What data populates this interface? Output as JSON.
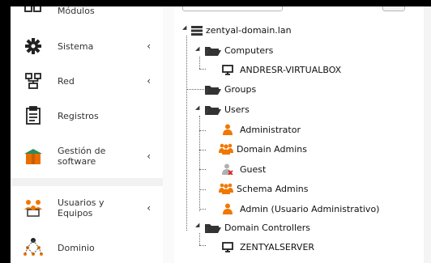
{
  "sidebar": {
    "items": [
      {
        "label": "Módulos",
        "icon": "modules-icon"
      },
      {
        "label": "Sistema",
        "icon": "gear-icon",
        "chevron": "‹"
      },
      {
        "label": "Red",
        "icon": "network-icon",
        "chevron": "‹"
      },
      {
        "label": "Registros",
        "icon": "clipboard-icon"
      },
      {
        "label": "Gestión de software",
        "icon": "software-box-icon",
        "chevron": "‹"
      },
      {
        "label": "Usuarios y Equipos",
        "icon": "users-group-icon",
        "chevron": "‹"
      },
      {
        "label": "Dominio",
        "icon": "domain-icon"
      }
    ]
  },
  "tree": {
    "root": "zentyal-domain.lan",
    "computers": "Computers",
    "computer_1": "ANDRESR-VIRTUALBOX",
    "groups": "Groups",
    "users": "Users",
    "user_1": "Administrator",
    "user_2": "Domain Admins",
    "user_3": "Guest",
    "user_4": "Schema Admins",
    "user_5": "Admin (Usuario Administrativo)",
    "dcs": "Domain Controllers",
    "dc_1": "ZENTYALSERVER"
  },
  "colors": {
    "user_orange": "#f07800",
    "folder_dark": "#333333",
    "box_green": "#2e8b57"
  }
}
